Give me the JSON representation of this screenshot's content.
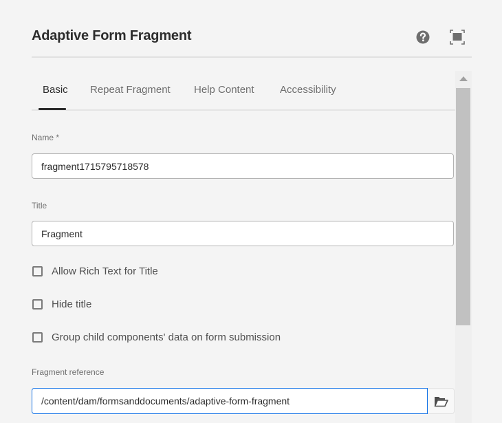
{
  "dialog": {
    "title": "Adaptive Form Fragment",
    "header_icons": [
      "help-icon",
      "fullscreen-icon"
    ]
  },
  "tabs": [
    {
      "label": "Basic",
      "active": true
    },
    {
      "label": "Repeat Fragment",
      "active": false
    },
    {
      "label": "Help Content",
      "active": false
    },
    {
      "label": "Accessibility",
      "active": false
    }
  ],
  "fields": {
    "name": {
      "label": "Name *",
      "value": "fragment1715795718578"
    },
    "title": {
      "label": "Title",
      "value": "Fragment"
    },
    "checkboxes": [
      {
        "label": "Allow Rich Text for Title",
        "checked": false
      },
      {
        "label": "Hide title",
        "checked": false
      },
      {
        "label": "Group child components' data on form submission",
        "checked": false
      }
    ],
    "fragment_reference": {
      "label": "Fragment reference",
      "value": "/content/dam/formsanddocuments/adaptive-form-fragment",
      "browse_icon": "folder-open-icon"
    }
  },
  "colors": {
    "background": "#f4f4f4",
    "focus_border": "#1473e6",
    "text": "#2c2c2c",
    "muted_text": "#6e6e6e"
  }
}
